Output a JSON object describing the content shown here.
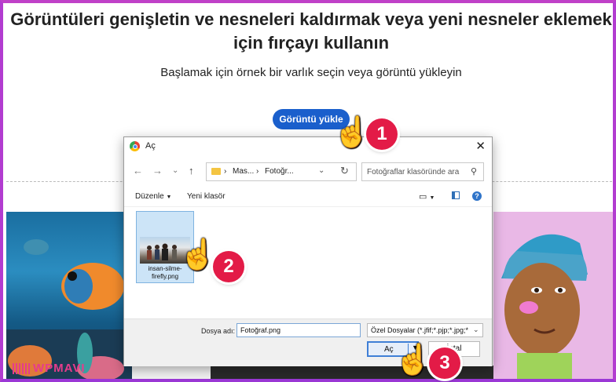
{
  "page": {
    "heading": "Görüntüleri genişletin ve nesneleri kaldırmak veya yeni nesneler eklemek için fırçayı kullanın",
    "subheading": "Başlamak için örnek bir varlık seçin veya görüntü yükleyin",
    "upload_button": "Görüntü yükle"
  },
  "dialog": {
    "title": "Aç",
    "close": "✕",
    "nav": {
      "back": "←",
      "forward": "→",
      "dropdown": "⌄",
      "up": "↑"
    },
    "address": {
      "crumbs": [
        "Mas...",
        "Fotoğr..."
      ],
      "separator": "›"
    },
    "search_placeholder": "Fotoğraflar klasöründe ara",
    "toolbar": {
      "organize": "Düzenle",
      "new_folder": "Yeni klasör"
    },
    "files": [
      {
        "name": "insan-silme-firefly.png",
        "selected": true
      }
    ],
    "footer": {
      "filename_label": "Dosya adı:",
      "filename_value": "Fotoğraf.png",
      "filetype_value": "Özel Dosyalar (*.jfif;*.pjp;*.jpg;*",
      "open_button": "Aç",
      "cancel_button": "İptal"
    }
  },
  "steps": [
    "1",
    "2",
    "3"
  ],
  "watermark": "WPMAVI",
  "colors": {
    "accent": "#1a5fcc",
    "badge": "#e31b47",
    "frame": "#b23cd0"
  }
}
